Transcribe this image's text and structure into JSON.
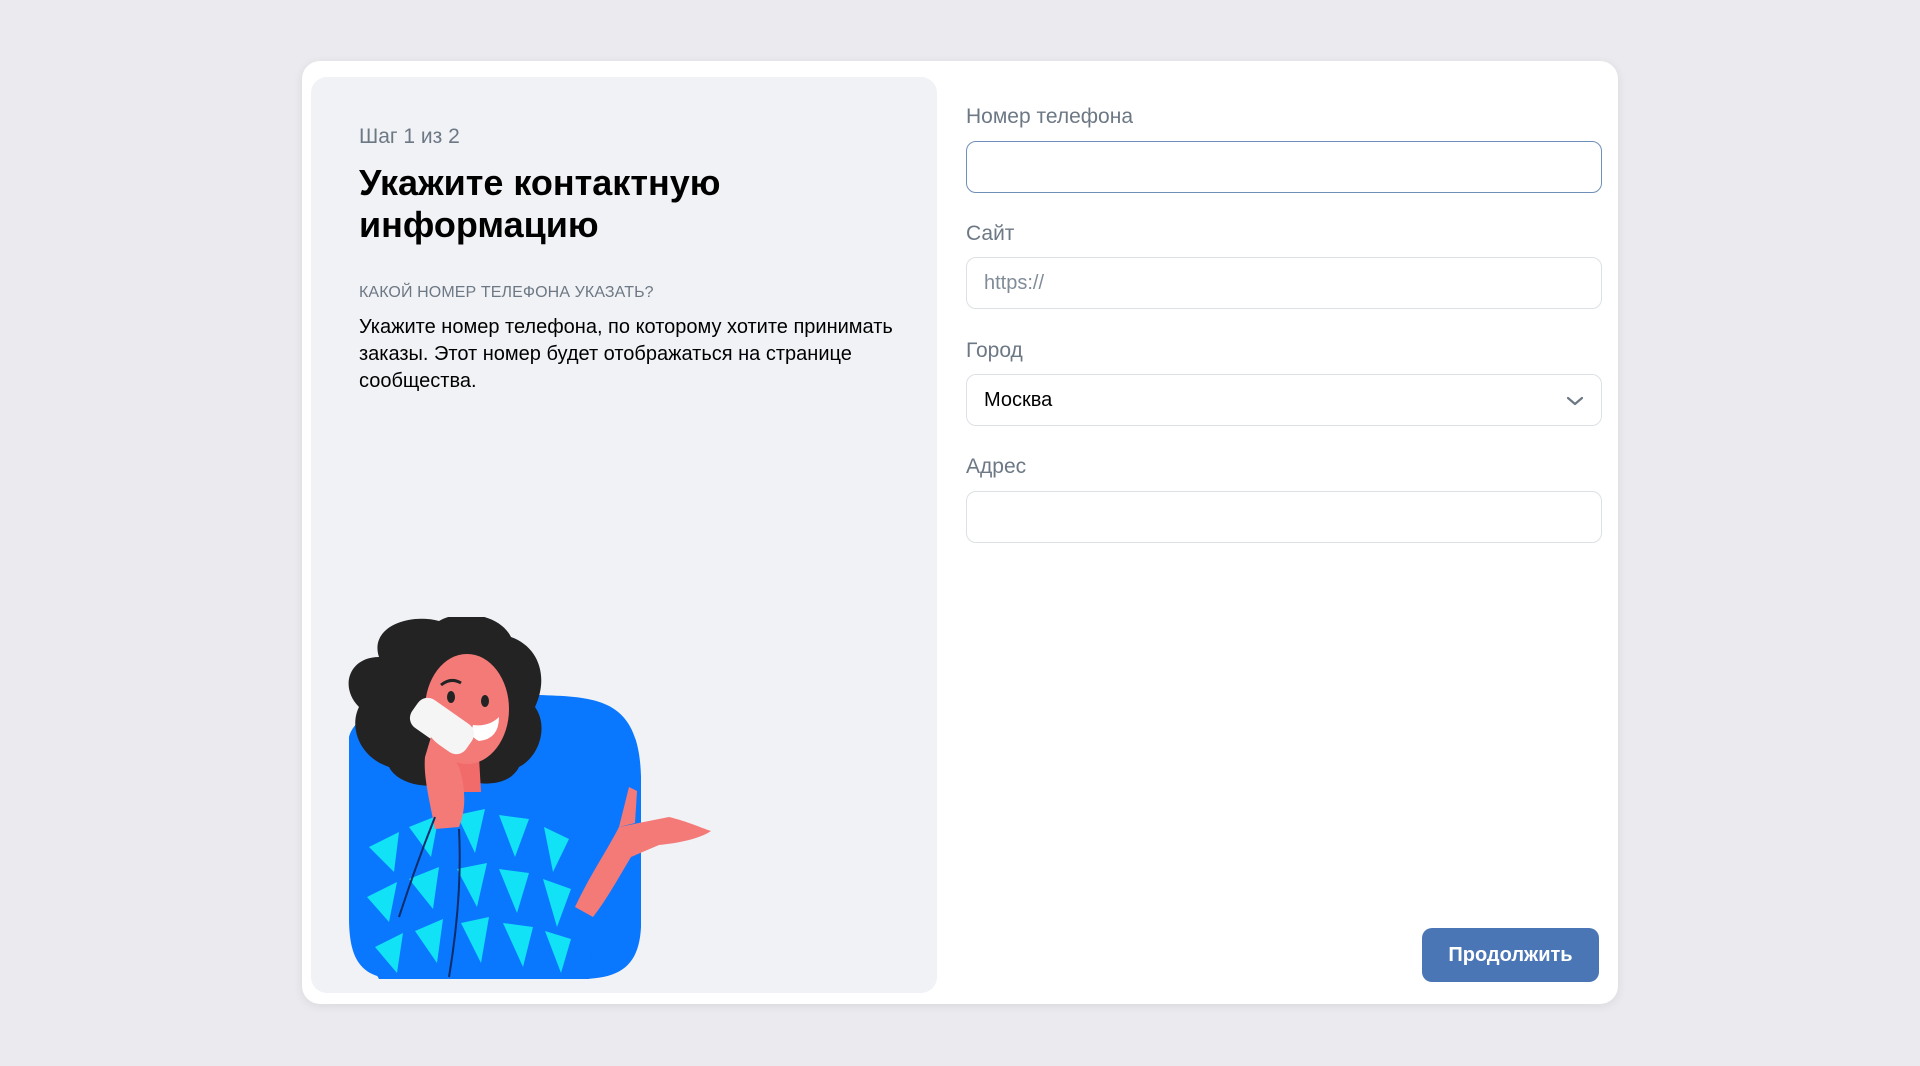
{
  "left": {
    "step": "Шаг 1 из 2",
    "title": "Укажите контактную информацию",
    "subheader": "КАКОЙ НОМЕР ТЕЛЕФОНА УКАЗАТЬ?",
    "description": "Укажите номер телефона, по которому хотите принимать заказы. Этот номер будет отображаться на странице сообщества."
  },
  "form": {
    "phone": {
      "label": "Номер телефона",
      "value": ""
    },
    "site": {
      "label": "Сайт",
      "placeholder": "https://"
    },
    "city": {
      "label": "Город",
      "value": "Москва"
    },
    "address": {
      "label": "Адрес",
      "value": ""
    }
  },
  "buttons": {
    "continue": "Продолжить"
  },
  "icons": {
    "city_dropdown": "chevron-down-icon",
    "illustration": "woman-on-phone-illustration"
  },
  "colors": {
    "page_bg": "#ebebef",
    "panel_bg": "#f0f2f5",
    "primary_button": "#4a76b5",
    "secondary_text": "#6d7885"
  }
}
